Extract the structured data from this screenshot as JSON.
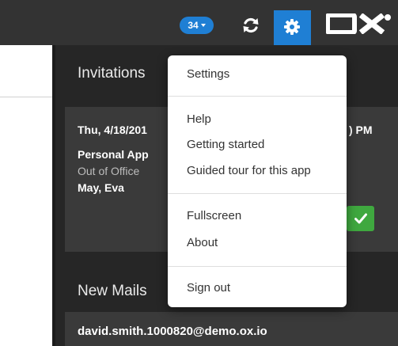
{
  "topbar": {
    "notifications_count": "34",
    "colors": {
      "bar": "#333333",
      "accent": "#1f7fd4"
    },
    "icons": [
      "refresh-icon",
      "gear-icon",
      "ox-logo"
    ]
  },
  "logo": {
    "text": "OX"
  },
  "sidepopup": {
    "invitations": {
      "title": "Invitations",
      "card": {
        "date_start": "Thu, 4/18/201",
        "date_end": ") PM",
        "title": "Personal App",
        "status": "Out of Office",
        "person": "May, Eva",
        "accept_icon": "check-icon",
        "accept_color": "#3fa83f"
      }
    },
    "new_mails": {
      "title": "New Mails",
      "first_sender": "david.smith.1000820@demo.ox.io"
    }
  },
  "menu": {
    "settings": "Settings",
    "help": "Help",
    "getting_started": "Getting started",
    "guided_tour": "Guided tour for this app",
    "fullscreen": "Fullscreen",
    "about": "About",
    "sign_out": "Sign out"
  }
}
